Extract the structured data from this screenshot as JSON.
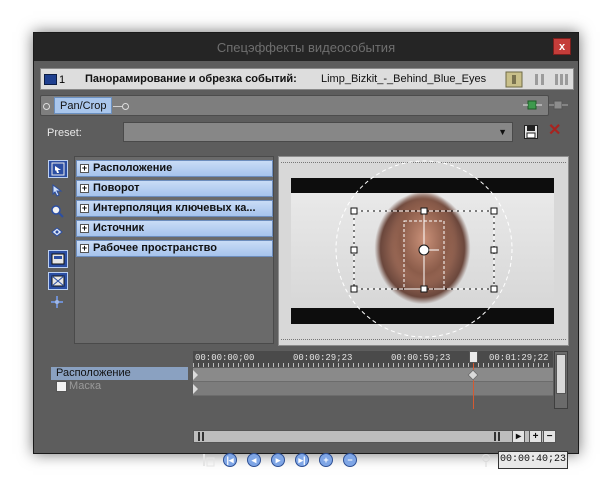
{
  "window": {
    "title": "Спецэффекты видеособытия",
    "close_label": "x"
  },
  "tabbar": {
    "track_number": "1",
    "label": "Панорамирование и обрезка событий:",
    "file_name": "Limp_Bizkit_-_Behind_Blue_Eyes"
  },
  "chain": {
    "plugin_label": "Pan/Crop"
  },
  "preset": {
    "label": "Preset:",
    "value": ""
  },
  "tools": [
    {
      "name": "normal-edit-tool-icon",
      "active": true
    },
    {
      "name": "move-tool-icon",
      "active": false
    },
    {
      "name": "zoom-tool-icon",
      "active": false
    },
    {
      "name": "rotate-tool-icon",
      "active": false
    },
    {
      "name": "enable-snapping-icon",
      "active": true
    },
    {
      "name": "lock-aspect-icon",
      "active": true
    },
    {
      "name": "move-freely-icon",
      "active": false
    }
  ],
  "properties": [
    {
      "label": "Расположение"
    },
    {
      "label": "Поворот"
    },
    {
      "label": "Интерполяция ключевых ка..."
    },
    {
      "label": "Источник"
    },
    {
      "label": "Рабочее пространство"
    }
  ],
  "timeline": {
    "tracks": [
      {
        "label": "Расположение"
      },
      {
        "label": "Маска",
        "checked": false
      }
    ],
    "ruler": [
      "00:00:00;00",
      "00:00:29;23",
      "00:00:59;23",
      "00:01:29;22"
    ],
    "current_time": "00:00:40;23"
  },
  "colors": {
    "accent": "#a9c6ec",
    "window_bg": "#5d5d5d",
    "titlebar": "#252525",
    "close": "#c43d3a",
    "playhead": "#d55a32"
  }
}
